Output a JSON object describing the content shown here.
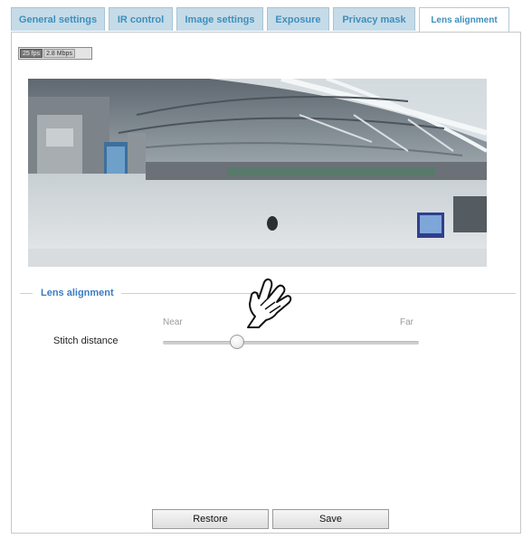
{
  "tabs": [
    {
      "label": "General settings"
    },
    {
      "label": "IR control"
    },
    {
      "label": "Image settings"
    },
    {
      "label": "Exposure"
    },
    {
      "label": "Privacy mask"
    },
    {
      "label": "Lens alignment",
      "active": true
    }
  ],
  "status": {
    "left": "25 fps",
    "right": "2.8 Mbps"
  },
  "viewer": {
    "icon": "panoramic-camera-view"
  },
  "lens_alignment": {
    "legend": "Lens alignment",
    "stitch": {
      "label": "Stitch distance",
      "min_label": "Near",
      "max_label": "Far",
      "value": 0.29
    }
  },
  "buttons": {
    "restore": "Restore",
    "save": "Save"
  },
  "colors": {
    "tab_bg": "#c5dbe8",
    "tab_text": "#3e8fbd",
    "legend_text": "#3a7ec2"
  }
}
